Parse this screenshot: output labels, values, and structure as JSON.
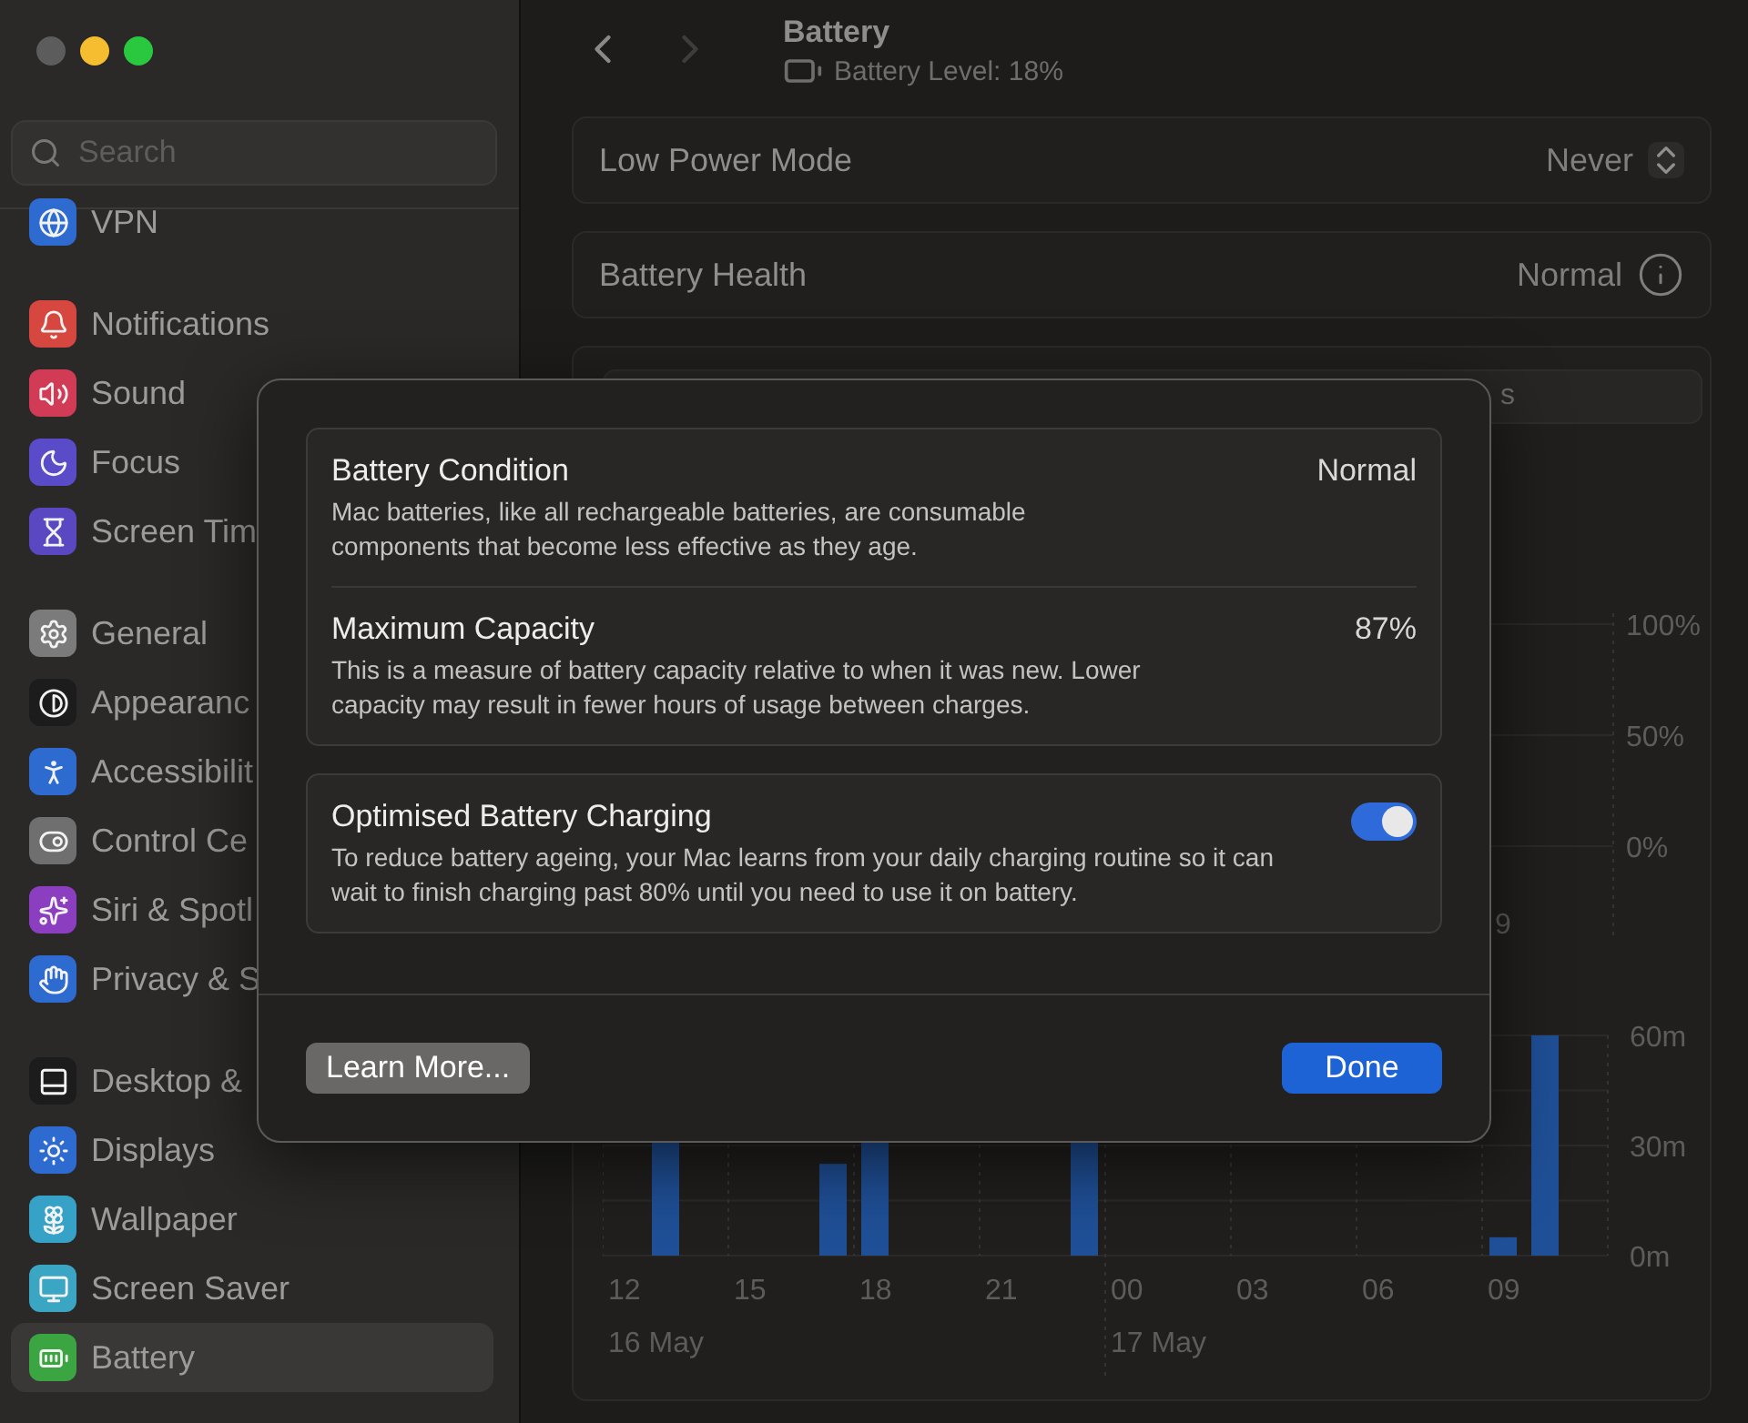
{
  "window": {
    "controls": [
      {
        "color": "#5c5c5c"
      },
      {
        "color": "#f5bd2f"
      },
      {
        "color": "#2ac83f"
      }
    ]
  },
  "sidebar": {
    "search": {
      "placeholder": "Search"
    },
    "groups": [
      {
        "items": [
          {
            "label": "VPN",
            "kind": "globe",
            "color": "#2e6bd1",
            "selected": false
          }
        ]
      },
      {
        "items": [
          {
            "label": "Notifications",
            "kind": "bell",
            "color": "#d6473f",
            "selected": false
          },
          {
            "label": "Sound",
            "kind": "speaker",
            "color": "#d23b55",
            "selected": false
          },
          {
            "label": "Focus",
            "kind": "moon",
            "color": "#5a4bc9",
            "selected": false
          },
          {
            "label": "Screen Tim",
            "kind": "hourglass",
            "color": "#5a47c2",
            "selected": false
          }
        ]
      },
      {
        "items": [
          {
            "label": "General",
            "kind": "gear",
            "color": "#7b7b7b",
            "selected": false
          },
          {
            "label": "Appearanc",
            "kind": "contrast",
            "color": "#1c1c1c",
            "selected": false
          },
          {
            "label": "Accessibilit",
            "kind": "person",
            "color": "#2e6bd1",
            "selected": false
          },
          {
            "label": "Control Ce",
            "kind": "toggles",
            "color": "#6f6f6f",
            "selected": false
          },
          {
            "label": "Siri & Spotl",
            "kind": "orb",
            "color": "#8b3fc0",
            "selected": false
          },
          {
            "label": "Privacy & S",
            "kind": "hand",
            "color": "#2e6bd1",
            "selected": false
          }
        ]
      },
      {
        "items": [
          {
            "label": "Desktop &",
            "kind": "dock",
            "color": "#1c1c1c",
            "selected": false
          },
          {
            "label": "Displays",
            "kind": "sun",
            "color": "#2e6bd1",
            "selected": false
          },
          {
            "label": "Wallpaper",
            "kind": "flower",
            "color": "#37a2c8",
            "selected": false
          },
          {
            "label": "Screen Saver",
            "kind": "monitor",
            "color": "#3aa6c4",
            "selected": false
          },
          {
            "label": "Battery",
            "kind": "battery",
            "color": "#3ba541",
            "selected": true
          }
        ]
      }
    ]
  },
  "header": {
    "nav": [
      {
        "kind": "back",
        "disabled": false
      },
      {
        "kind": "forward",
        "disabled": true
      }
    ],
    "title": "Battery",
    "subtitle": "Battery Level: 18%"
  },
  "settings": [
    {
      "label": "Low Power Mode",
      "value": "Never",
      "kind": "popup"
    },
    {
      "label": "Battery Health",
      "value": "Normal",
      "kind": "info"
    }
  ],
  "usage": {
    "segmented_control": {
      "text": "s"
    },
    "level_chart": {
      "yticks": [
        "100%",
        "50%",
        "0%"
      ],
      "xlabel": "9"
    },
    "usage_chart": {
      "ylabels": [
        "60m",
        "30m",
        "0m"
      ],
      "xlabels": [
        "12",
        "15",
        "18",
        "21",
        "00",
        "03",
        "06",
        "09"
      ],
      "dates": [
        "16 May",
        "17 May"
      ]
    }
  },
  "dialog": {
    "groups": [
      {
        "rows": [
          {
            "kind": "value",
            "title": "Battery Condition",
            "value": "Normal",
            "description": "Mac batteries, like all rechargeable batteries, are consumable components that become less effective as they age."
          },
          {
            "kind": "value",
            "title": "Maximum Capacity",
            "value": "87%",
            "description": "This is a measure of battery capacity relative to when it was new. Lower capacity may result in fewer hours of usage between charges."
          }
        ]
      },
      {
        "rows": [
          {
            "kind": "toggle",
            "title": "Optimised Battery Charging",
            "on": true,
            "description": "To reduce battery ageing, your Mac learns from your daily charging routine so it can wait to finish charging past 80% until you need to use it on battery."
          }
        ]
      }
    ],
    "buttons": [
      {
        "kind": "secondary",
        "label": "Learn More..."
      },
      {
        "kind": "primary",
        "label": "Done"
      }
    ]
  }
}
